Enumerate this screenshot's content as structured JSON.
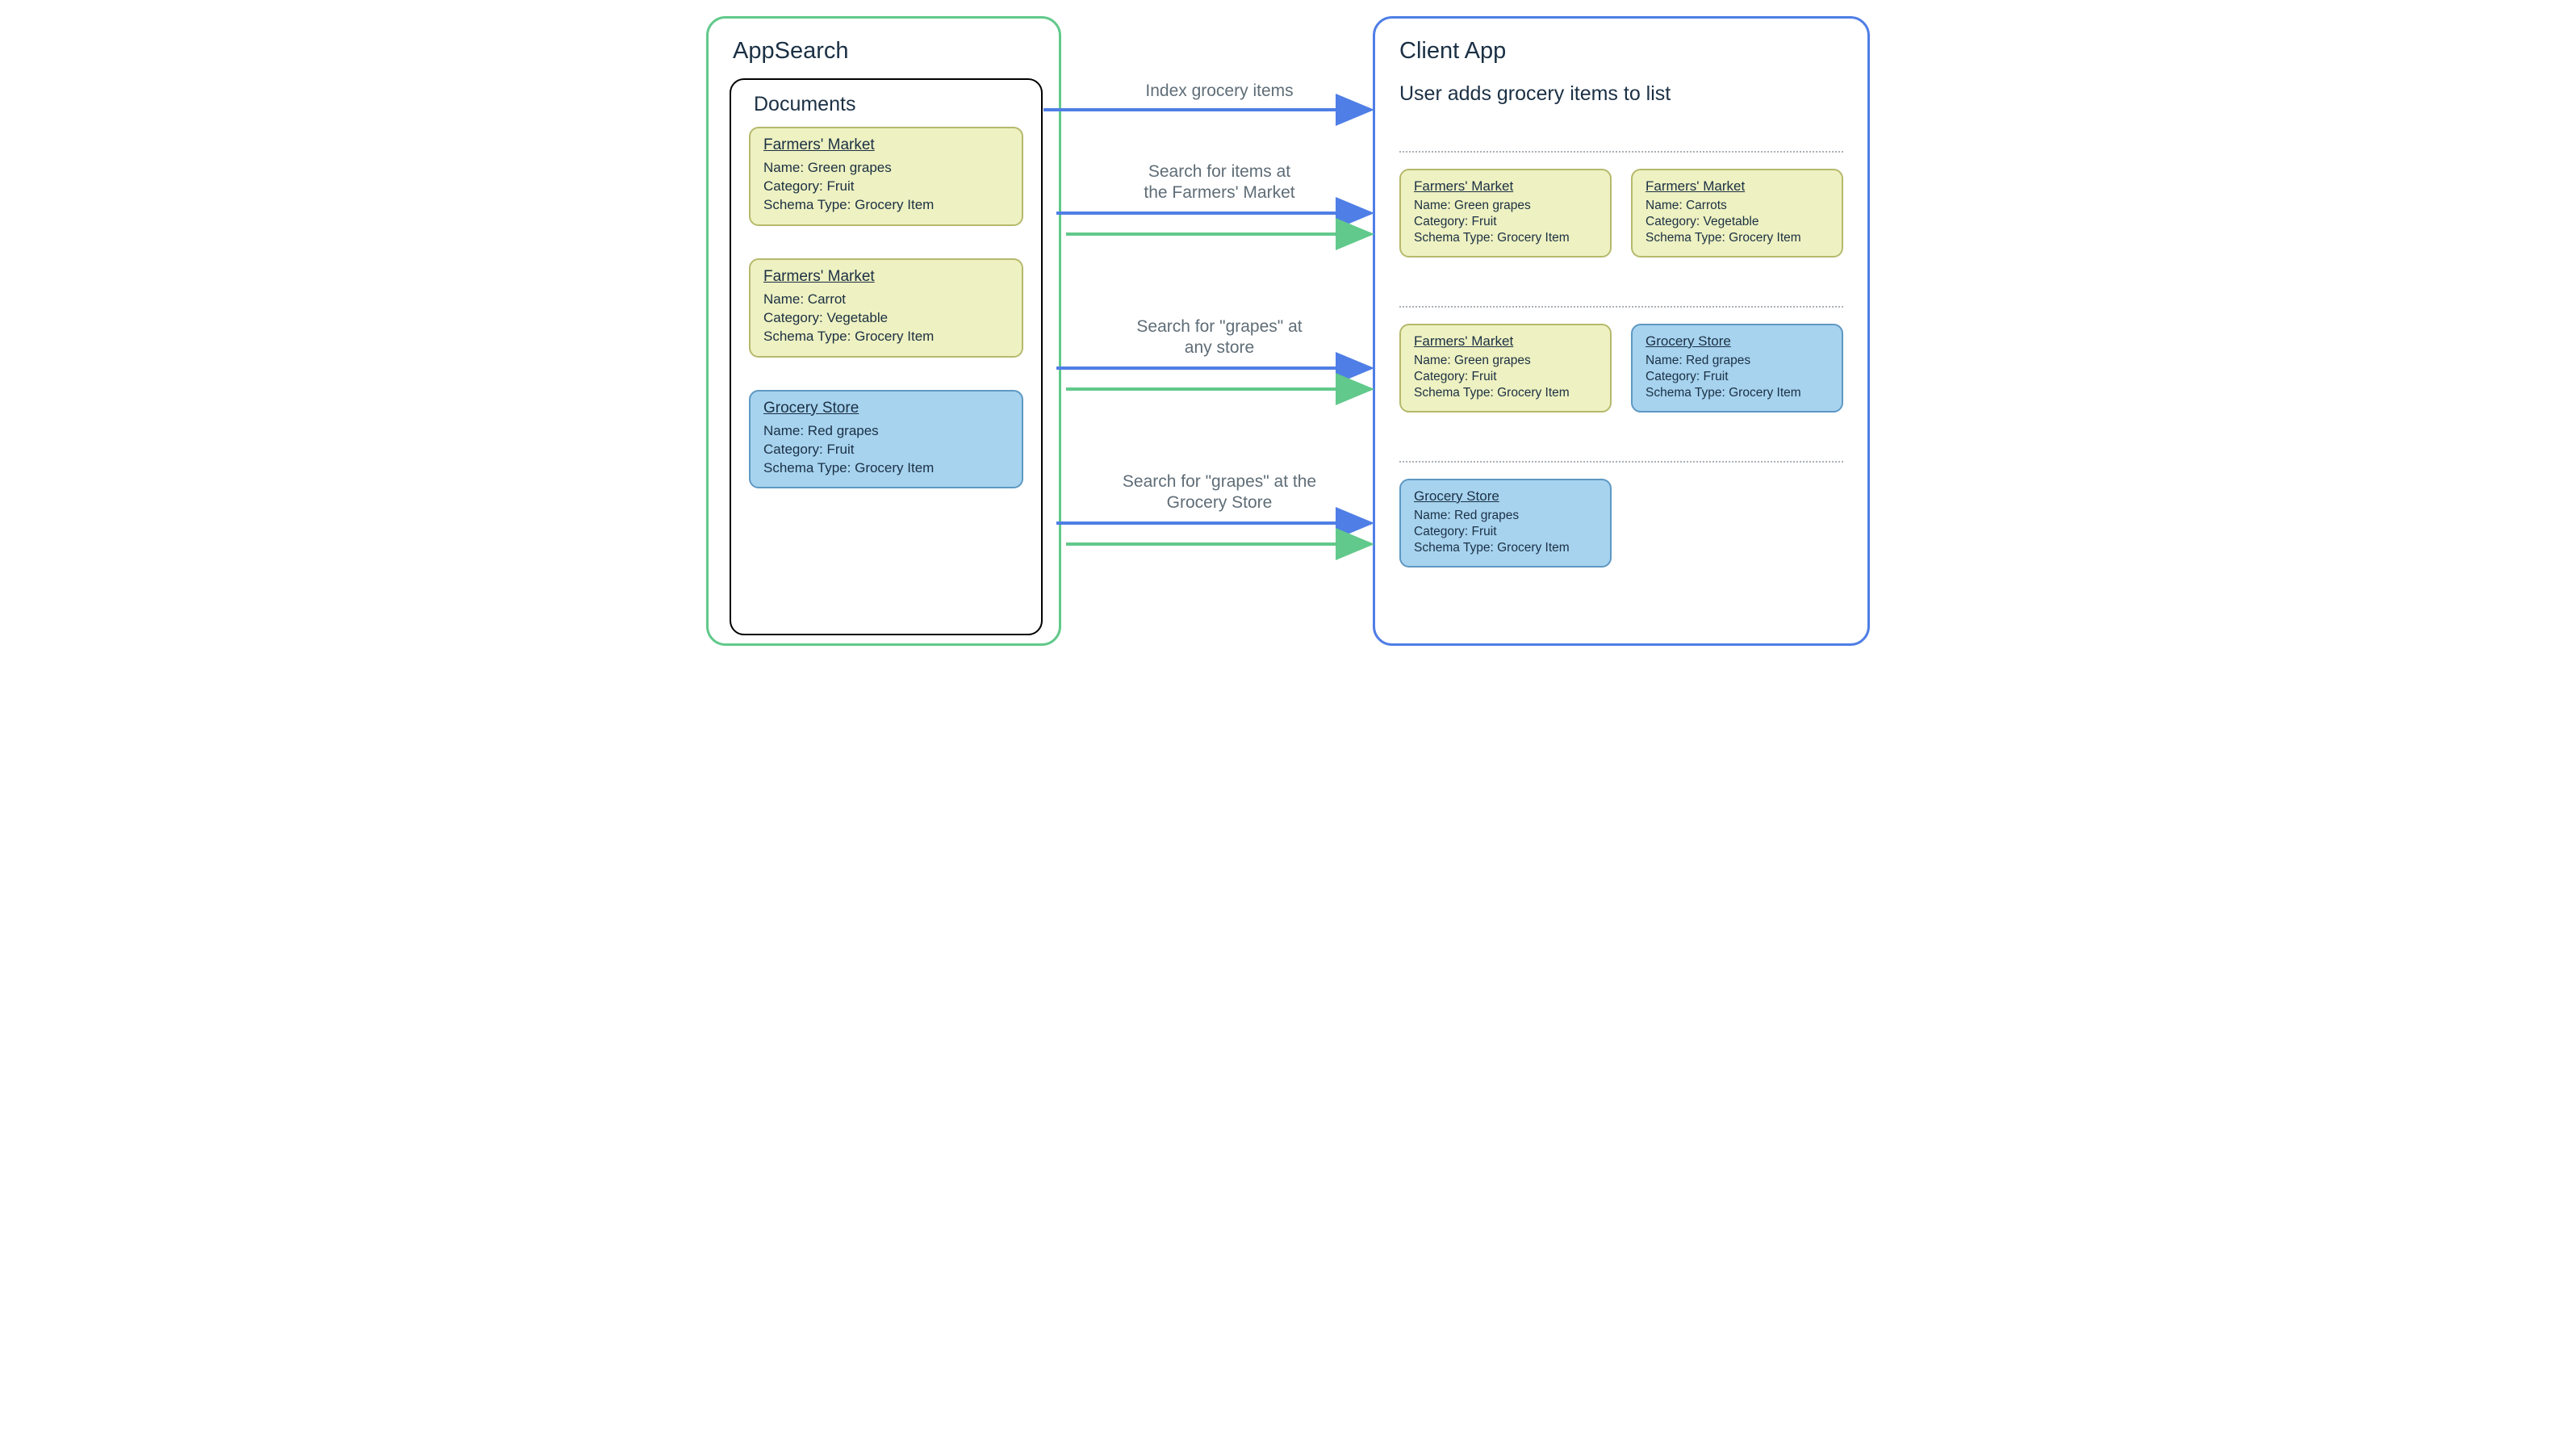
{
  "left": {
    "title": "AppSearch",
    "docsTitle": "Documents",
    "docs": [
      {
        "store": "Farmers' Market",
        "name": "Green grapes",
        "category": "Fruit",
        "schema": "Grocery Item",
        "variant": "yellow"
      },
      {
        "store": "Farmers' Market",
        "name": "Carrot",
        "category": "Vegetable",
        "schema": "Grocery Item",
        "variant": "yellow"
      },
      {
        "store": "Grocery Store",
        "name": "Red grapes",
        "category": "Fruit",
        "schema": "Grocery Item",
        "variant": "blue"
      }
    ]
  },
  "right": {
    "title": "Client App",
    "subtitle": "User adds grocery items to list",
    "rows": [
      [
        {
          "store": "Farmers' Market",
          "name": "Green grapes",
          "category": "Fruit",
          "schema": "Grocery Item",
          "variant": "yellow"
        },
        {
          "store": "Farmers' Market",
          "name": "Carrots",
          "category": "Vegetable",
          "schema": "Grocery Item",
          "variant": "yellow"
        }
      ],
      [
        {
          "store": "Farmers' Market",
          "name": "Green grapes",
          "category": "Fruit",
          "schema": "Grocery Item",
          "variant": "yellow"
        },
        {
          "store": "Grocery Store",
          "name": "Red grapes",
          "category": "Fruit",
          "schema": "Grocery Item",
          "variant": "blue"
        }
      ],
      [
        {
          "store": "Grocery Store",
          "name": "Red grapes",
          "category": "Fruit",
          "schema": "Grocery Item",
          "variant": "blue"
        }
      ]
    ]
  },
  "labels": {
    "fieldName": "Name: ",
    "fieldCategory": "Category: ",
    "fieldSchema": "Schema Type: "
  },
  "arrows": {
    "a1": "Index grocery items",
    "a2l1": "Search for items at",
    "a2l2": "the Farmers' Market",
    "a3l1": "Search for \"grapes\" at",
    "a3l2": "any store",
    "a4l1": "Search for \"grapes\" at the",
    "a4l2": "Grocery Store"
  },
  "colors": {
    "green": "#61c98b",
    "blue": "#4f7ee6",
    "yellowCard": "#eef1c1",
    "blueCard": "#a7d3ef"
  }
}
